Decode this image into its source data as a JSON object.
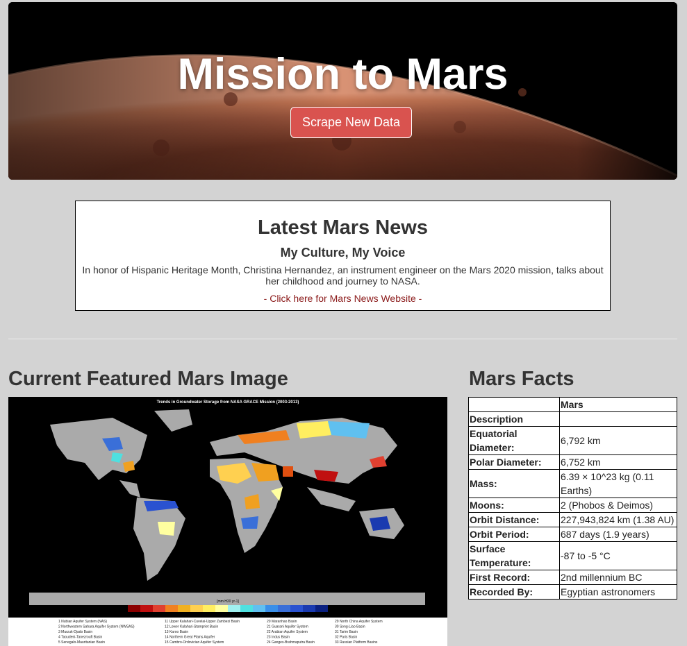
{
  "hero": {
    "title": "Mission to Mars",
    "button_label": "Scrape New Data"
  },
  "news": {
    "heading": "Latest Mars News",
    "title": "My Culture, My Voice",
    "teaser": "In honor of Hispanic Heritage Month, Christina Hernandez, an instrument engineer on the Mars 2020 mission, talks about her childhood and journey to NASA.",
    "link_text": "- Click here for Mars News Website -"
  },
  "featured": {
    "heading": "Current Featured Mars Image",
    "image_caption": "Trends in Groundwater Storage from NASA GRACE Mission (2003-2013)",
    "colorbar_unit": "[mm H20 yr-1]",
    "colorbar_ticks": [
      "-20",
      "-15",
      "-10",
      "-5",
      "0",
      "5",
      "10",
      "15",
      "20"
    ],
    "legend_col1": [
      "1   Nubian Aquifer System (NAS)",
      "2   Northwestern Sahara Aquifer System (NWSAS)",
      "3   Murzuk-Djado Basin",
      "4   Taoudeni-Tanezrouft Basin",
      "5   Senegalo-Mauritanian Basin"
    ],
    "legend_col2": [
      "11  Upper Kalahari-Cuvelai-Upper Zambezi Basin",
      "12  Lower Kalahari-Stampriet Basin",
      "13  Karoo Basin",
      "14  Northern Great Plains Aquifer",
      "15  Cambro-Ordovician Aquifer System"
    ],
    "legend_col3": [
      "20  Maranhao Basin",
      "21  Guarani Aquifer System",
      "22  Arabian Aquifer System",
      "23  Indus Basin",
      "24  Ganges-Brahmaputra Basin"
    ],
    "legend_col4": [
      "29  North China Aquifer System",
      "30  Song-Liao Basin",
      "31  Tarim Basin",
      "32  Paris Basin",
      "33  Russian Platform Basins"
    ]
  },
  "facts": {
    "heading": "Mars Facts",
    "column_header": "Mars",
    "rows": [
      {
        "label": "Description",
        "value": ""
      },
      {
        "label": "Equatorial Diameter:",
        "value": "6,792 km"
      },
      {
        "label": "Polar Diameter:",
        "value": "6,752 km"
      },
      {
        "label": "Mass:",
        "value": "6.39 × 10^23 kg (0.11 Earths)"
      },
      {
        "label": "Moons:",
        "value": "2 (Phobos & Deimos)"
      },
      {
        "label": "Orbit Distance:",
        "value": "227,943,824 km (1.38 AU)"
      },
      {
        "label": "Orbit Period:",
        "value": "687 days (1.9 years)"
      },
      {
        "label": "Surface Temperature:",
        "value": "-87 to -5 °C"
      },
      {
        "label": "First Record:",
        "value": "2nd millennium BC"
      },
      {
        "label": "Recorded By:",
        "value": "Egyptian astronomers"
      }
    ]
  },
  "colors": {
    "background": "#d3d3d3",
    "button": "#d9534f",
    "link": "#8b1a1a"
  }
}
